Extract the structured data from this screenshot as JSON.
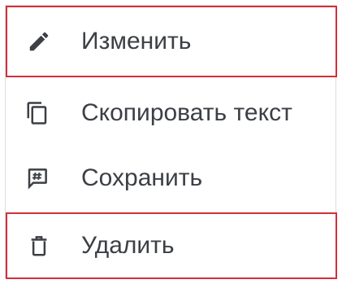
{
  "menu": {
    "items": [
      {
        "label": "Изменить",
        "icon": "pencil-icon",
        "highlighted": true
      },
      {
        "label": "Скопировать текст",
        "icon": "copy-icon",
        "highlighted": false
      },
      {
        "label": "Сохранить",
        "icon": "hash-comment-icon",
        "highlighted": false
      },
      {
        "label": "Удалить",
        "icon": "trash-icon",
        "highlighted": true
      }
    ]
  },
  "colors": {
    "text": "#3c3f44",
    "icon": "#3c3f44",
    "highlight_border": "#d32f3a",
    "menu_border": "#dddddd",
    "background": "#ffffff"
  }
}
